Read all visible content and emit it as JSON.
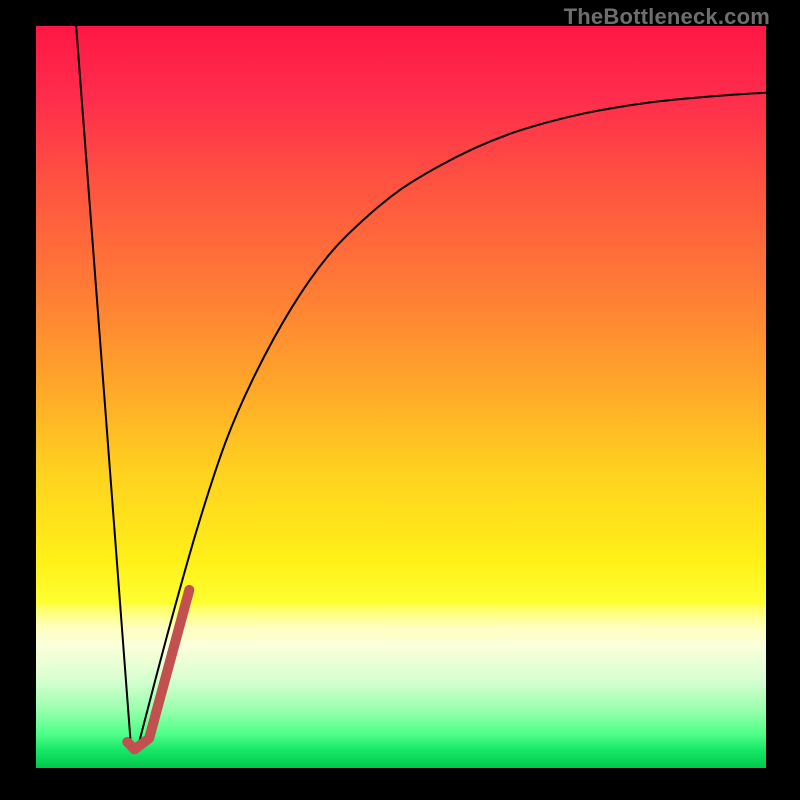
{
  "watermark": "TheBottleneck.com",
  "chart_data": {
    "type": "line",
    "title": "",
    "xlabel": "",
    "ylabel": "",
    "xlim": [
      0,
      100
    ],
    "ylim": [
      0,
      100
    ],
    "band_y": [
      16,
      22
    ],
    "series": [
      {
        "name": "left-line",
        "x": [
          5.5,
          13.0
        ],
        "values": [
          100,
          3
        ],
        "color": "#000000",
        "width": 2
      },
      {
        "name": "right-curve",
        "x": [
          14,
          18,
          22,
          26,
          30,
          35,
          40,
          45,
          50,
          55,
          60,
          65,
          70,
          75,
          80,
          85,
          90,
          95,
          100
        ],
        "values": [
          3,
          18,
          32,
          44,
          53,
          62,
          69,
          74,
          78,
          81,
          83.5,
          85.5,
          87,
          88.2,
          89.1,
          89.8,
          90.3,
          90.7,
          91
        ],
        "color": "#000000",
        "width": 2
      },
      {
        "name": "j-stroke",
        "x": [
          12.5,
          13.5,
          15.5,
          21.0
        ],
        "values": [
          3.5,
          2.5,
          4.0,
          24.0
        ],
        "color": "#c1504f",
        "width": 10
      }
    ],
    "gradient_stops": [
      {
        "offset": 0.0,
        "color": "#ff1744"
      },
      {
        "offset": 0.1,
        "color": "#ff2e4c"
      },
      {
        "offset": 0.22,
        "color": "#ff5540"
      },
      {
        "offset": 0.35,
        "color": "#ff7a36"
      },
      {
        "offset": 0.48,
        "color": "#ffa52a"
      },
      {
        "offset": 0.6,
        "color": "#ffd11f"
      },
      {
        "offset": 0.72,
        "color": "#fff018"
      },
      {
        "offset": 0.78,
        "color": "#ffff33"
      },
      {
        "offset": 0.81,
        "color": "#ffffb0"
      },
      {
        "offset": 0.84,
        "color": "#f8ffd8"
      },
      {
        "offset": 0.88,
        "color": "#d8ffd0"
      },
      {
        "offset": 0.92,
        "color": "#9cffb0"
      },
      {
        "offset": 0.955,
        "color": "#4cff88"
      },
      {
        "offset": 0.975,
        "color": "#18e868"
      },
      {
        "offset": 1.0,
        "color": "#00c84c"
      }
    ]
  }
}
